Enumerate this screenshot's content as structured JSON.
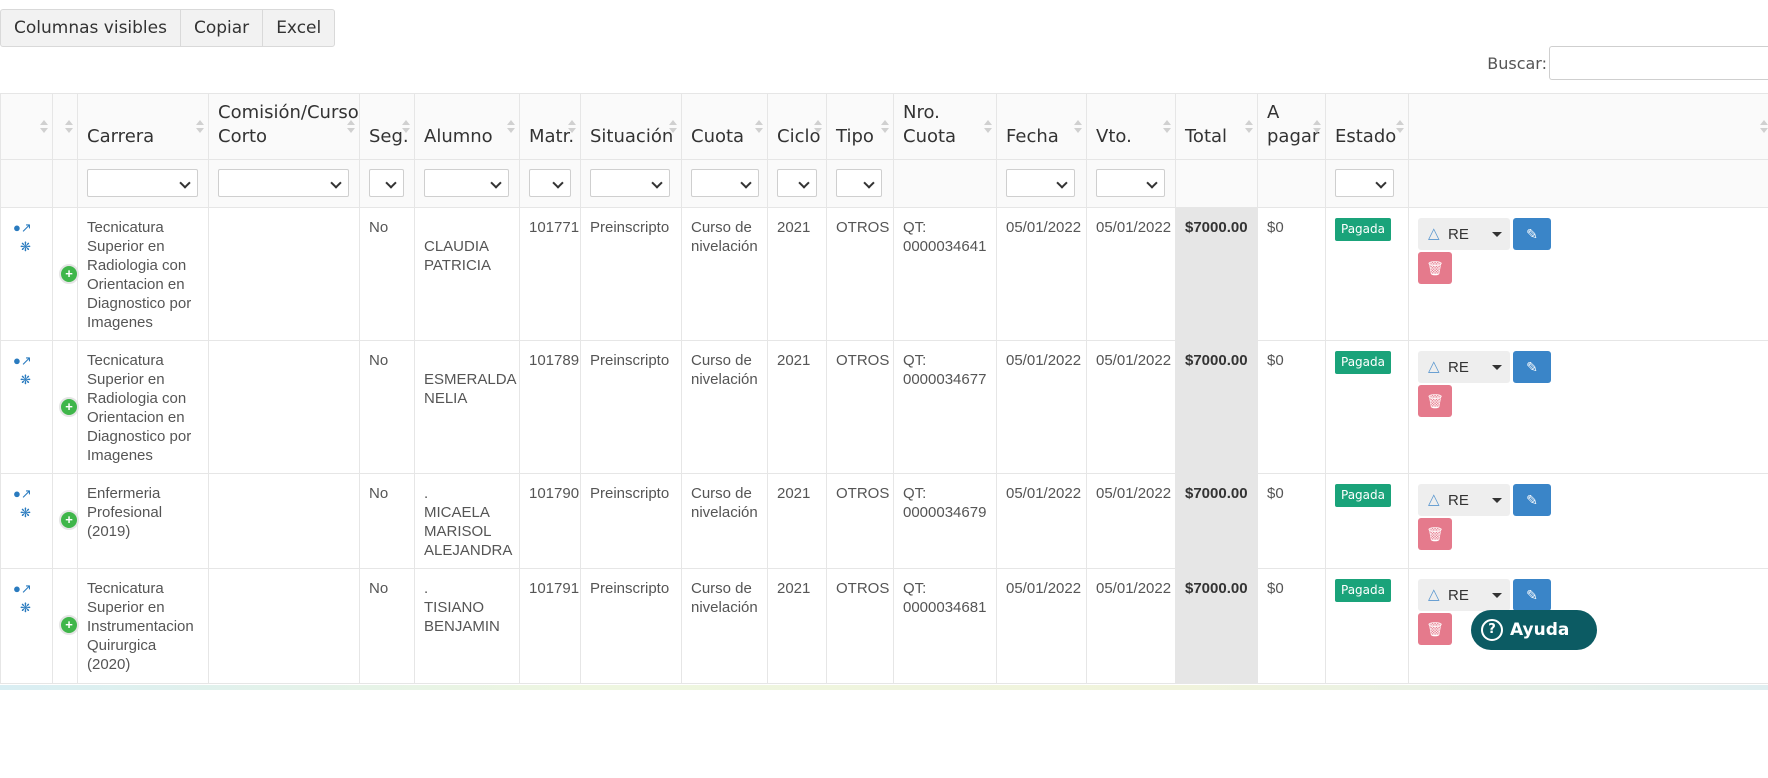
{
  "toolbar": {
    "columns": "Columnas visibles",
    "copy": "Copiar",
    "excel": "Excel"
  },
  "search": {
    "label": "Buscar:",
    "value": ""
  },
  "headers": {
    "carrera": "Carrera",
    "comision": "Comisión/Curso Corto",
    "seg": "Seg.",
    "alumno": "Alumno",
    "matr": "Matr.",
    "situacion": "Situación",
    "cuota": "Cuota",
    "ciclo": "Ciclo",
    "tipo": "Tipo",
    "nro_cuota": "Nro. Cuota",
    "fecha": "Fecha",
    "vto": "Vto.",
    "total": "Total",
    "a_pagar": "A pagar",
    "estado": "Estado"
  },
  "rows": [
    {
      "carrera": "Tecnicatura Superior en Radiologia con Orientacion en Diagnostico por Imagenes",
      "comision": "",
      "seg": "No",
      "alumno_prefix": "",
      "alumno": "CLAUDIA PATRICIA",
      "matr": "101771",
      "situacion": "Preinscripto",
      "cuota": "Curso de nivelación",
      "ciclo": "2021",
      "tipo": "OTROS",
      "nro_cuota": "QT: 0000034641",
      "fecha": "05/01/2022",
      "vto": "05/01/2022",
      "total": "$7000.00",
      "a_pagar": "$0",
      "estado": "Pagada",
      "action": "RE"
    },
    {
      "carrera": "Tecnicatura Superior en Radiologia con Orientacion en Diagnostico por Imagenes",
      "comision": "",
      "seg": "No",
      "alumno_prefix": "",
      "alumno": "ESMERALDA NELIA",
      "matr": "101789",
      "situacion": "Preinscripto",
      "cuota": "Curso de nivelación",
      "ciclo": "2021",
      "tipo": "OTROS",
      "nro_cuota": "QT: 0000034677",
      "fecha": "05/01/2022",
      "vto": "05/01/2022",
      "total": "$7000.00",
      "a_pagar": "$0",
      "estado": "Pagada",
      "action": "RE"
    },
    {
      "carrera": "Enfermeria Profesional (2019)",
      "comision": "",
      "seg": "No",
      "alumno_prefix": ".",
      "alumno": "MICAELA MARISOL ALEJANDRA",
      "matr": "101790",
      "situacion": "Preinscripto",
      "cuota": "Curso de nivelación",
      "ciclo": "2021",
      "tipo": "OTROS",
      "nro_cuota": "QT: 0000034679",
      "fecha": "05/01/2022",
      "vto": "05/01/2022",
      "total": "$7000.00",
      "a_pagar": "$0",
      "estado": "Pagada",
      "action": "RE"
    },
    {
      "carrera": "Tecnicatura Superior en Instrumentacion Quirurgica (2020)",
      "comision": "",
      "seg": "No",
      "alumno_prefix": ".",
      "alumno": "TISIANO BENJAMIN",
      "matr": "101791",
      "situacion": "Preinscripto",
      "cuota": "Curso de nivelación",
      "ciclo": "2021",
      "tipo": "OTROS",
      "nro_cuota": "QT: 0000034681",
      "fecha": "05/01/2022",
      "vto": "05/01/2022",
      "total": "$7000.00",
      "a_pagar": "$0",
      "estado": "Pagada",
      "action": "RE"
    }
  ],
  "help": {
    "label": "Ayuda"
  },
  "colors": {
    "accent": "#3a85c8",
    "paid_badge": "#1aa37a",
    "delete": "#e57a8c",
    "help": "#0c5b63",
    "add": "#3fb64a"
  }
}
